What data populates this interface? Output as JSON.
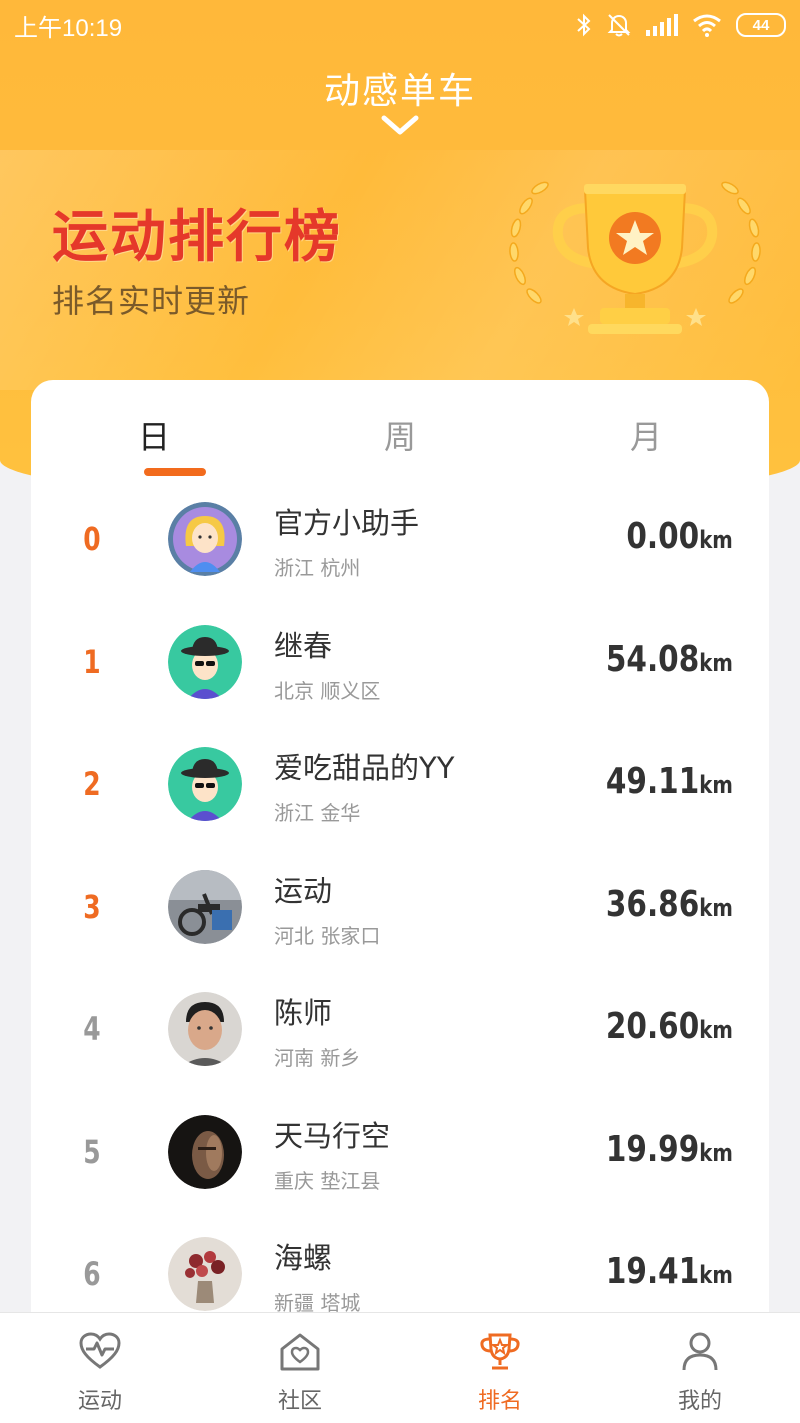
{
  "status": {
    "time": "上午10:19",
    "battery": "44"
  },
  "header": {
    "title": "动感单车"
  },
  "banner": {
    "title": "运动排行榜",
    "subtitle": "排名实时更新"
  },
  "tabs": [
    {
      "label": "日",
      "active": true
    },
    {
      "label": "周",
      "active": false
    },
    {
      "label": "月",
      "active": false
    }
  ],
  "ranking": [
    {
      "rank": "0",
      "name": "官方小助手",
      "location": "浙江 杭州",
      "distance": "0.00",
      "unit": "km"
    },
    {
      "rank": "1",
      "name": "继春",
      "location": "北京 顺义区",
      "distance": "54.08",
      "unit": "km"
    },
    {
      "rank": "2",
      "name": "爱吃甜品的YY",
      "location": "浙江 金华",
      "distance": "49.11",
      "unit": "km"
    },
    {
      "rank": "3",
      "name": "运动",
      "location": "河北 张家口",
      "distance": "36.86",
      "unit": "km"
    },
    {
      "rank": "4",
      "name": "陈师",
      "location": "河南 新乡",
      "distance": "20.60",
      "unit": "km"
    },
    {
      "rank": "5",
      "name": "天马行空",
      "location": "重庆 垫江县",
      "distance": "19.99",
      "unit": "km"
    },
    {
      "rank": "6",
      "name": "海螺",
      "location": "新疆 塔城",
      "distance": "19.41",
      "unit": "km"
    }
  ],
  "bottom_nav": [
    {
      "label": "运动",
      "icon": "heart-pulse-icon",
      "active": false
    },
    {
      "label": "社区",
      "icon": "home-heart-icon",
      "active": false
    },
    {
      "label": "排名",
      "icon": "trophy-icon",
      "active": true
    },
    {
      "label": "我的",
      "icon": "user-icon",
      "active": false
    }
  ],
  "colors": {
    "accent": "#ef6b22",
    "header": "#ffb83a",
    "banner_title": "#e5382a"
  }
}
